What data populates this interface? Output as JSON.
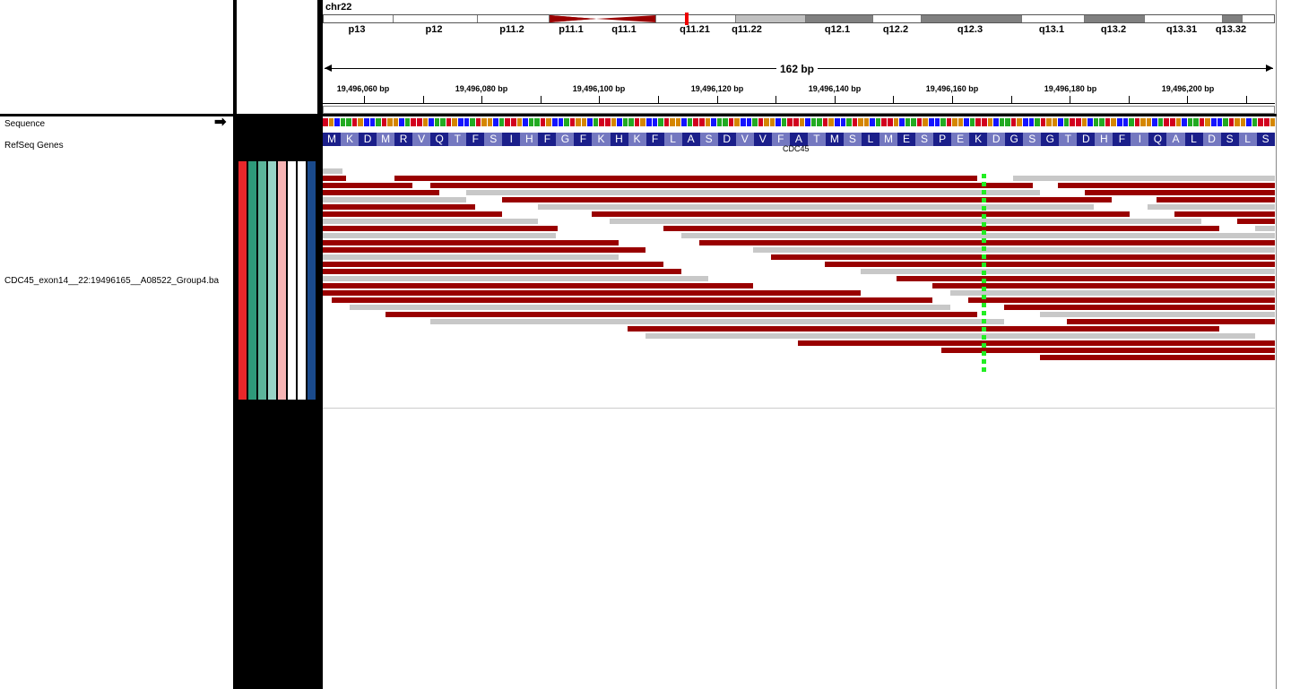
{
  "header": {
    "chromosome": "chr22",
    "span": "162 bp",
    "bands": [
      "p13",
      "p12",
      "p11.2",
      "p11.1",
      "q11.1",
      "q11.21",
      "q11.22",
      "q12.1",
      "q12.2",
      "q12.3",
      "q13.1",
      "q13.2",
      "q13.31",
      "q13.32"
    ],
    "ticks": [
      "19,496,060 bp",
      "19,496,080 bp",
      "19,496,100 bp",
      "19,496,120 bp",
      "19,496,140 bp",
      "19,496,160 bp",
      "19,496,180 bp",
      "19,496,200 bp"
    ]
  },
  "tracks": {
    "sequence": "Sequence",
    "refseq": "RefSeq Genes",
    "alignment": "CDC45_exon14__22:19496165__A08522_Group4.ba",
    "gene_name": "CDC45"
  },
  "amino_acids": [
    "M",
    "K",
    "D",
    "M",
    "R",
    "V",
    "Q",
    "T",
    "F",
    "S",
    "I",
    "H",
    "F",
    "G",
    "F",
    "K",
    "H",
    "K",
    "F",
    "L",
    "A",
    "S",
    "D",
    "V",
    "V",
    "F",
    "A",
    "T",
    "M",
    "S",
    "L",
    "M",
    "E",
    "S",
    "P",
    "E",
    "K",
    "D",
    "G",
    "S",
    "G",
    "T",
    "D",
    "H",
    "F",
    "I",
    "Q",
    "A",
    "L",
    "D",
    "S",
    "L",
    "S"
  ],
  "colors": {
    "read_forward": "#990000",
    "read_gray": "#c8c8c8",
    "mismatch": "#22ee22",
    "aa_dark": "#1b1f8a",
    "aa_light": "#7478c0",
    "attribute_columns": [
      "#e8282b",
      "#2e9a7a",
      "#5cb59a",
      "#98d4c6",
      "#f7b4b4",
      "#ffffff",
      "#ffffff",
      "#1a4a8c"
    ]
  }
}
